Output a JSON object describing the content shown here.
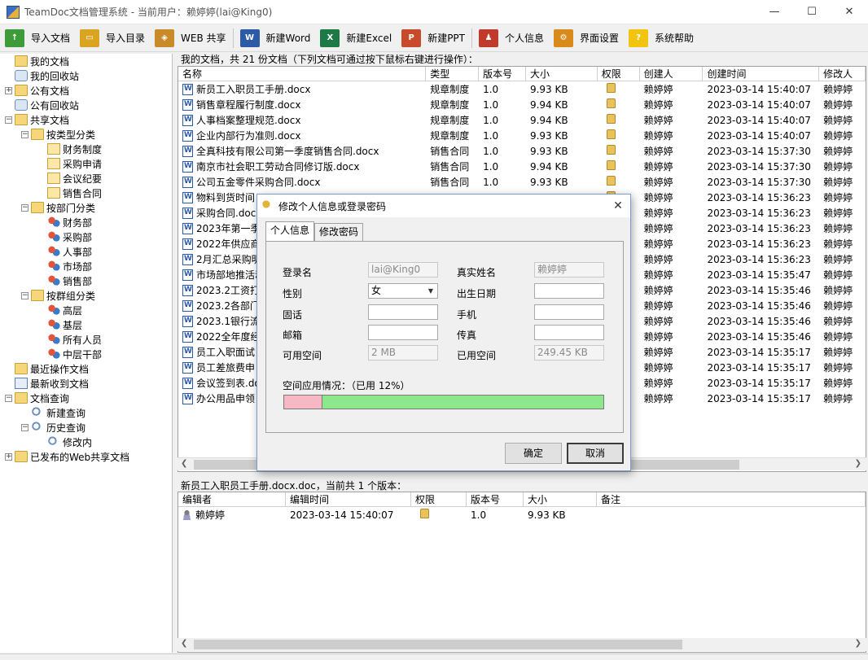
{
  "window": {
    "title": "TeamDoc文档管理系统 - 当前用户：赖婷婷(lai@King0)",
    "controls": {
      "minimize": "—",
      "maximize": "☐",
      "close": "✕"
    }
  },
  "toolbar": {
    "buttons": [
      {
        "label": "导入文档",
        "icon": "import-document-icon",
        "color": "#3f9a3a"
      },
      {
        "label": "导入目录",
        "icon": "import-folder-icon",
        "color": "#d9a520"
      },
      {
        "label": "WEB 共享",
        "icon": "web-share-icon",
        "color": "#c98a2a"
      },
      {
        "label": "新建Word",
        "icon": "word-icon",
        "color": "#2d5aa6"
      },
      {
        "label": "新建Excel",
        "icon": "excel-icon",
        "color": "#1e7a45"
      },
      {
        "label": "新建PPT",
        "icon": "ppt-icon",
        "color": "#c94a2a"
      },
      {
        "label": "个人信息",
        "icon": "personal-info-icon",
        "color": "#c0392b"
      },
      {
        "label": "界面设置",
        "icon": "gear-icon",
        "color": "#d88a1a"
      },
      {
        "label": "系统帮助",
        "icon": "help-icon",
        "color": "#f1c40f"
      }
    ]
  },
  "tree": {
    "items": [
      {
        "label": "我的文档",
        "level": 1,
        "icon": "folder"
      },
      {
        "label": "我的回收站",
        "level": 1,
        "icon": "bin"
      },
      {
        "label": "公有文档",
        "level": 1,
        "icon": "folder",
        "exp": "+"
      },
      {
        "label": "公有回收站",
        "level": 1,
        "icon": "bin"
      },
      {
        "label": "共享文档",
        "level": 1,
        "icon": "folder",
        "exp": "−"
      },
      {
        "label": "按类型分类",
        "level": 2,
        "icon": "folder",
        "exp": "−"
      },
      {
        "label": "财务制度",
        "level": 3,
        "icon": "folder-open"
      },
      {
        "label": "采购申请",
        "level": 3,
        "icon": "folder-open"
      },
      {
        "label": "会议纪要",
        "level": 3,
        "icon": "folder-open"
      },
      {
        "label": "销售合同",
        "level": 3,
        "icon": "folder-open"
      },
      {
        "label": "按部门分类",
        "level": 2,
        "icon": "folder",
        "exp": "−"
      },
      {
        "label": "财务部",
        "level": 3,
        "icon": "group"
      },
      {
        "label": "采购部",
        "level": 3,
        "icon": "group"
      },
      {
        "label": "人事部",
        "level": 3,
        "icon": "group"
      },
      {
        "label": "市场部",
        "level": 3,
        "icon": "group"
      },
      {
        "label": "销售部",
        "level": 3,
        "icon": "group"
      },
      {
        "label": "按群组分类",
        "level": 2,
        "icon": "folder",
        "exp": "−"
      },
      {
        "label": "高层",
        "level": 3,
        "icon": "group"
      },
      {
        "label": "基层",
        "level": 3,
        "icon": "group"
      },
      {
        "label": "所有人员",
        "level": 3,
        "icon": "group"
      },
      {
        "label": "中层干部",
        "level": 3,
        "icon": "group"
      },
      {
        "label": "最近操作文档",
        "level": 1,
        "icon": "folder"
      },
      {
        "label": "最新收到文档",
        "level": 1,
        "icon": "doc"
      },
      {
        "label": "文档查询",
        "level": 1,
        "icon": "folder",
        "exp": "−"
      },
      {
        "label": "新建查询",
        "level": 2,
        "icon": "search"
      },
      {
        "label": "历史查询",
        "level": 2,
        "icon": "search",
        "exp": "−"
      },
      {
        "label": "修改内",
        "level": 3,
        "icon": "search"
      },
      {
        "label": "已发布的Web共享文档",
        "level": 1,
        "icon": "folder",
        "exp": "+"
      }
    ]
  },
  "doc_list": {
    "title": "我的文档，共 21 份文档（下列文档可通过按下鼠标右键进行操作）：",
    "columns": [
      "名称",
      "类型",
      "版本号",
      "大小",
      "权限",
      "创建人",
      "创建时间",
      "修改人"
    ],
    "rows": [
      {
        "name": "新员工入职员工手册.docx",
        "type": "规章制度",
        "ver": "1.0",
        "size": "9.93 KB",
        "creator": "赖婷婷",
        "ctime": "2023-03-14 15:40:07",
        "mod": "赖婷婷"
      },
      {
        "name": "销售章程履行制度.docx",
        "type": "规章制度",
        "ver": "1.0",
        "size": "9.94 KB",
        "creator": "赖婷婷",
        "ctime": "2023-03-14 15:40:07",
        "mod": "赖婷婷"
      },
      {
        "name": "人事档案整理规范.docx",
        "type": "规章制度",
        "ver": "1.0",
        "size": "9.94 KB",
        "creator": "赖婷婷",
        "ctime": "2023-03-14 15:40:07",
        "mod": "赖婷婷"
      },
      {
        "name": "企业内部行为准则.docx",
        "type": "规章制度",
        "ver": "1.0",
        "size": "9.93 KB",
        "creator": "赖婷婷",
        "ctime": "2023-03-14 15:40:07",
        "mod": "赖婷婷"
      },
      {
        "name": "全真科技有限公司第一季度销售合同.docx",
        "type": "销售合同",
        "ver": "1.0",
        "size": "9.93 KB",
        "creator": "赖婷婷",
        "ctime": "2023-03-14 15:37:30",
        "mod": "赖婷婷"
      },
      {
        "name": "南京市社会职工劳动合同修订版.docx",
        "type": "销售合同",
        "ver": "1.0",
        "size": "9.94 KB",
        "creator": "赖婷婷",
        "ctime": "2023-03-14 15:37:30",
        "mod": "赖婷婷"
      },
      {
        "name": "公司五金零件采购合同.docx",
        "type": "销售合同",
        "ver": "1.0",
        "size": "9.93 KB",
        "creator": "赖婷婷",
        "ctime": "2023-03-14 15:37:30",
        "mod": "赖婷婷"
      },
      {
        "name": "物料到货时间",
        "type": "",
        "ver": "",
        "size": "",
        "creator": "赖婷婷",
        "ctime": "2023-03-14 15:36:23",
        "mod": "赖婷婷"
      },
      {
        "name": "采购合同.docx",
        "type": "",
        "ver": "",
        "size": "",
        "creator": "赖婷婷",
        "ctime": "2023-03-14 15:36:23",
        "mod": "赖婷婷"
      },
      {
        "name": "2023年第一季",
        "type": "",
        "ver": "",
        "size": "",
        "creator": "赖婷婷",
        "ctime": "2023-03-14 15:36:23",
        "mod": "赖婷婷"
      },
      {
        "name": "2022年供应商",
        "type": "",
        "ver": "",
        "size": "",
        "creator": "赖婷婷",
        "ctime": "2023-03-14 15:36:23",
        "mod": "赖婷婷"
      },
      {
        "name": "2月汇总采购明",
        "type": "",
        "ver": "",
        "size": "",
        "creator": "赖婷婷",
        "ctime": "2023-03-14 15:36:23",
        "mod": "赖婷婷"
      },
      {
        "name": "市场部地推活动",
        "type": "",
        "ver": "",
        "size": "",
        "creator": "赖婷婷",
        "ctime": "2023-03-14 15:35:47",
        "mod": "赖婷婷"
      },
      {
        "name": "2023.2工资打",
        "type": "",
        "ver": "",
        "size": "",
        "creator": "赖婷婷",
        "ctime": "2023-03-14 15:35:46",
        "mod": "赖婷婷"
      },
      {
        "name": "2023.2各部门",
        "type": "",
        "ver": "",
        "size": "",
        "creator": "赖婷婷",
        "ctime": "2023-03-14 15:35:46",
        "mod": "赖婷婷"
      },
      {
        "name": "2023.1银行流",
        "type": "",
        "ver": "",
        "size": "",
        "creator": "赖婷婷",
        "ctime": "2023-03-14 15:35:46",
        "mod": "赖婷婷"
      },
      {
        "name": "2022全年度经",
        "type": "",
        "ver": "",
        "size": "",
        "creator": "赖婷婷",
        "ctime": "2023-03-14 15:35:46",
        "mod": "赖婷婷"
      },
      {
        "name": "员工入职面试",
        "type": "",
        "ver": "",
        "size": "",
        "creator": "赖婷婷",
        "ctime": "2023-03-14 15:35:17",
        "mod": "赖婷婷"
      },
      {
        "name": "员工差旅费申",
        "type": "",
        "ver": "",
        "size": "",
        "creator": "赖婷婷",
        "ctime": "2023-03-14 15:35:17",
        "mod": "赖婷婷"
      },
      {
        "name": "会议签到表.do",
        "type": "",
        "ver": "",
        "size": "",
        "creator": "赖婷婷",
        "ctime": "2023-03-14 15:35:17",
        "mod": "赖婷婷"
      },
      {
        "name": "办公用品申领",
        "type": "",
        "ver": "",
        "size": "",
        "creator": "赖婷婷",
        "ctime": "2023-03-14 15:35:17",
        "mod": "赖婷婷"
      }
    ]
  },
  "versions": {
    "title": "新员工入职员工手册.docx.doc，当前共 1 个版本：",
    "columns": [
      "编辑者",
      "编辑时间",
      "权限",
      "版本号",
      "大小",
      "备注"
    ],
    "rows": [
      {
        "editor": "赖婷婷",
        "time": "2023-03-14 15:40:07",
        "ver": "1.0",
        "size": "9.93 KB",
        "note": ""
      }
    ]
  },
  "dialog": {
    "title": "修改个人信息或登录密码",
    "close": "✕",
    "tabs": [
      "个人信息",
      "修改密码"
    ],
    "labels": {
      "login": "登录名",
      "realname": "真实姓名",
      "gender": "性别",
      "birthday": "出生日期",
      "phone": "固话",
      "mobile": "手机",
      "email": "邮箱",
      "fax": "传真",
      "avail": "可用空间",
      "used": "已用空间"
    },
    "values": {
      "login": "lai@King0",
      "realname": "赖婷婷",
      "gender": "女",
      "birthday": "",
      "phone": "",
      "mobile": "",
      "email": "",
      "fax": "",
      "avail": "2 MB",
      "used": "249.45 KB"
    },
    "usage_text": "空间应用情况：（已用 12%）",
    "usage_percent": 12,
    "ok": "确定",
    "cancel": "取消"
  }
}
